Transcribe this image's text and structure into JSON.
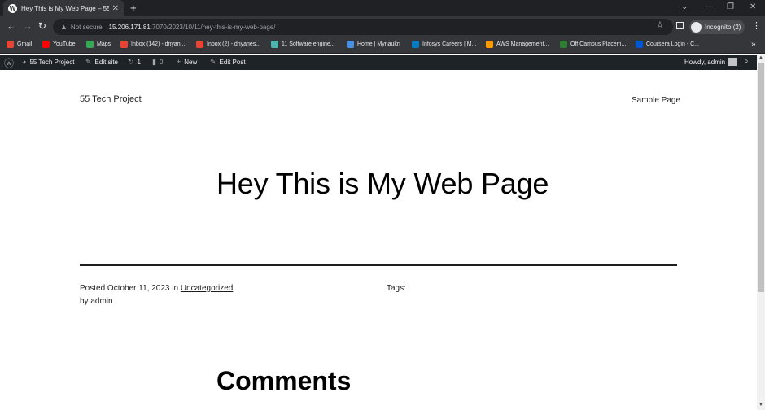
{
  "browser": {
    "tab_title": "Hey This is My Web Page – 55 Te",
    "url_security": "Not secure",
    "url_host": "15.206.171.81",
    "url_path": ":7070/2023/10/11/hey-this-is-my-web-page/",
    "incognito_label": "Incognito (2)",
    "bookmarks": [
      {
        "label": "Gmail",
        "color": "#ea4335"
      },
      {
        "label": "YouTube",
        "color": "#ff0000"
      },
      {
        "label": "Maps",
        "color": "#34a853"
      },
      {
        "label": "Inbox (142) - dnyan...",
        "color": "#ea4335"
      },
      {
        "label": "Inbox (2) - dnyanes...",
        "color": "#ea4335"
      },
      {
        "label": "11 Software engine...",
        "color": "#4db6ac"
      },
      {
        "label": "Home | Mynaukri",
        "color": "#4a90e2"
      },
      {
        "label": "Infosys Careers | M...",
        "color": "#007cc3"
      },
      {
        "label": "AWS Management...",
        "color": "#ff9900"
      },
      {
        "label": "Off Campus Placem...",
        "color": "#2e7d32"
      },
      {
        "label": "Coursera Login - C...",
        "color": "#0056d2"
      }
    ]
  },
  "adminbar": {
    "site_name": "55 Tech Project",
    "edit_site": "Edit site",
    "updates_count": "1",
    "comments_count": "0",
    "new_label": "New",
    "edit_post": "Edit Post",
    "howdy": "Howdy, admin"
  },
  "page": {
    "site_title": "55 Tech Project",
    "nav_link": "Sample Page",
    "post_title": "Hey This is My Web Page",
    "posted_prefix": "Posted",
    "posted_date": "October 11, 2023",
    "in_word": "in",
    "category": "Uncategorized",
    "by_line": "by admin",
    "tags_label": "Tags:",
    "comments_heading": "Comments"
  }
}
